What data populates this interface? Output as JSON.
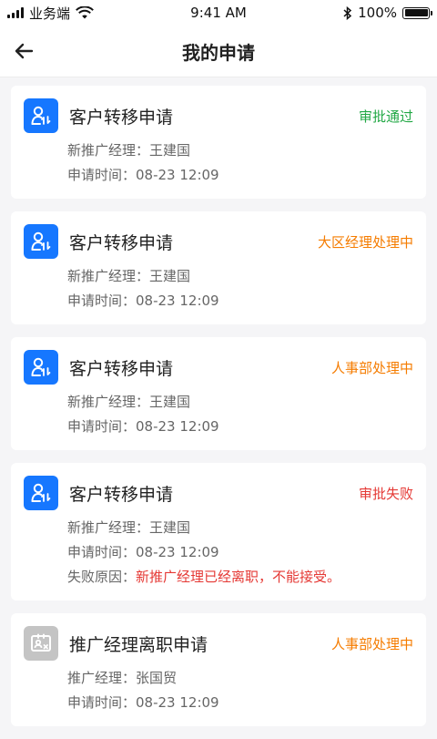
{
  "status_bar": {
    "carrier": "业务端",
    "time": "9:41 AM",
    "battery": "100%"
  },
  "nav": {
    "title": "我的申请"
  },
  "colors": {
    "accent": "#1677ff",
    "approved": "#22a845",
    "processing": "#f57c00",
    "failed": "#e53935"
  },
  "cards": [
    {
      "icon": "user-transfer-icon",
      "title": "客户转移申请",
      "status": "审批通过",
      "rows": [
        {
          "label": "新推广经理：",
          "value": "王建国"
        },
        {
          "label": "申请时间：",
          "value": "08-23 12:09"
        }
      ]
    },
    {
      "icon": "user-transfer-icon",
      "title": "客户转移申请",
      "status": "大区经理处理中",
      "rows": [
        {
          "label": "新推广经理：",
          "value": "王建国"
        },
        {
          "label": "申请时间：",
          "value": "08-23 12:09"
        }
      ]
    },
    {
      "icon": "user-transfer-icon",
      "title": "客户转移申请",
      "status": "人事部处理中",
      "rows": [
        {
          "label": "新推广经理：",
          "value": "王建国"
        },
        {
          "label": "申请时间：",
          "value": "08-23 12:09"
        }
      ]
    },
    {
      "icon": "user-transfer-icon",
      "title": "客户转移申请",
      "status": "审批失败",
      "rows": [
        {
          "label": "新推广经理：",
          "value": "王建国"
        },
        {
          "label": "申请时间：",
          "value": "08-23 12:09"
        },
        {
          "label": "失败原因：",
          "value": "新推广经理已经离职，不能接受。"
        }
      ]
    },
    {
      "icon": "id-card-resign-icon",
      "title": "推广经理离职申请",
      "status": "人事部处理中",
      "rows": [
        {
          "label": "推广经理：",
          "value": "张国贸"
        },
        {
          "label": "申请时间：",
          "value": "08-23 12:09"
        }
      ]
    }
  ]
}
